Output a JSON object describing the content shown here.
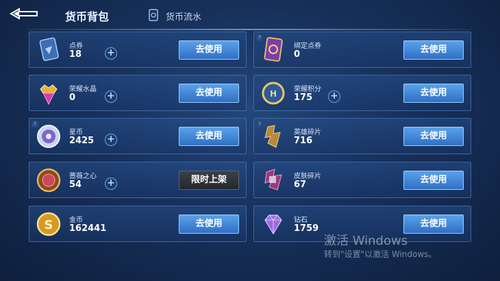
{
  "header": {
    "title": "货币背包",
    "flow_label": "货币流水"
  },
  "cards": [
    {
      "name": "点券",
      "amount": "18",
      "button": "去使用",
      "icon": "ticket-icon"
    },
    {
      "name": "绑定点券",
      "amount": "0",
      "button": "去使用",
      "icon": "bound-ticket-icon"
    },
    {
      "name": "荣耀水晶",
      "amount": "0",
      "button": "去使用",
      "icon": "glory-crystal-icon"
    },
    {
      "name": "荣耀积分",
      "amount": "175",
      "button": "去使用",
      "icon": "glory-points-icon"
    },
    {
      "name": "星币",
      "amount": "2425",
      "button": "去使用",
      "icon": "star-coin-icon"
    },
    {
      "name": "英雄碎片",
      "amount": "716",
      "button": "去使用",
      "icon": "hero-fragment-icon"
    },
    {
      "name": "蔷薇之心",
      "amount": "54",
      "button": "限时上架",
      "icon": "rose-heart-icon"
    },
    {
      "name": "皮肤碎片",
      "amount": "67",
      "button": "去使用",
      "icon": "skin-fragment-icon"
    },
    {
      "name": "金币",
      "amount": "162441",
      "button": "去使用",
      "icon": "gold-coin-icon"
    },
    {
      "name": "钻石",
      "amount": "1759",
      "button": "去使用",
      "icon": "diamond-icon"
    }
  ],
  "watermark": {
    "line1": "激活 Windows",
    "line2": "转到\"设置\"以激活 Windows。"
  },
  "colors": {
    "background": "#17305a",
    "button_blue": "#3f86d8",
    "button_dark": "#2b2f37",
    "card_border": "#5a8cd2"
  }
}
